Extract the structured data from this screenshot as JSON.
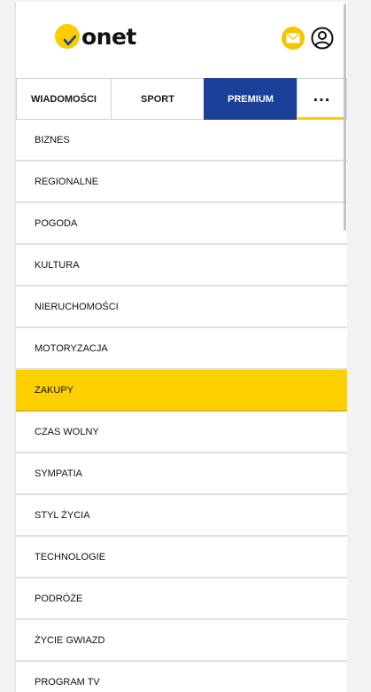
{
  "header": {
    "logo_text": "onet",
    "mail_icon": "mail-icon",
    "user_icon": "user-account-icon"
  },
  "tabs": [
    {
      "label": "WIADOMOŚCI"
    },
    {
      "label": "SPORT"
    },
    {
      "label": "PREMIUM",
      "active": true
    },
    {
      "label": "..."
    }
  ],
  "menu": {
    "items": [
      {
        "label": "BIZNES"
      },
      {
        "label": "REGIONALNE"
      },
      {
        "label": "POGODA"
      },
      {
        "label": "KULTURA"
      },
      {
        "label": "NIERUCHOMOŚCI"
      },
      {
        "label": "MOTORYZACJA"
      },
      {
        "label": "ZAKUPY",
        "highlighted": true
      },
      {
        "label": "CZAS WOLNY"
      },
      {
        "label": "SYMPATIA"
      },
      {
        "label": "STYL ŻYCIA"
      },
      {
        "label": "TECHNOLOGIE"
      },
      {
        "label": "PODRÓŻE"
      },
      {
        "label": "ŻYCIE GWIAZD"
      },
      {
        "label": "PROGRAM TV"
      }
    ]
  },
  "colors": {
    "brand_yellow": "#ffcc00",
    "premium_blue": "#1a409a",
    "highlight_yellow": "#ffd000"
  }
}
